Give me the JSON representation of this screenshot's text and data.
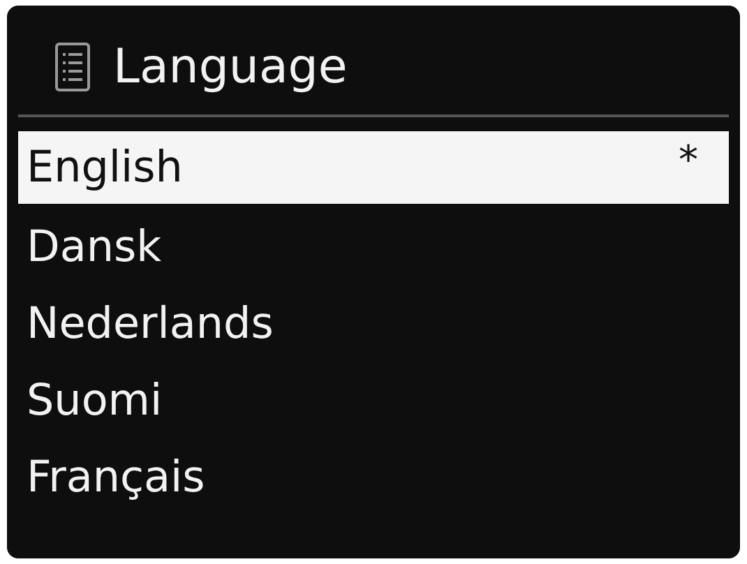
{
  "title": "Language",
  "items": [
    {
      "label": "English",
      "marker": "*",
      "selected": true
    },
    {
      "label": "Dansk",
      "selected": false
    },
    {
      "label": "Nederlands",
      "selected": false
    },
    {
      "label": "Suomi",
      "selected": false
    },
    {
      "label": "Français",
      "selected": false
    }
  ]
}
